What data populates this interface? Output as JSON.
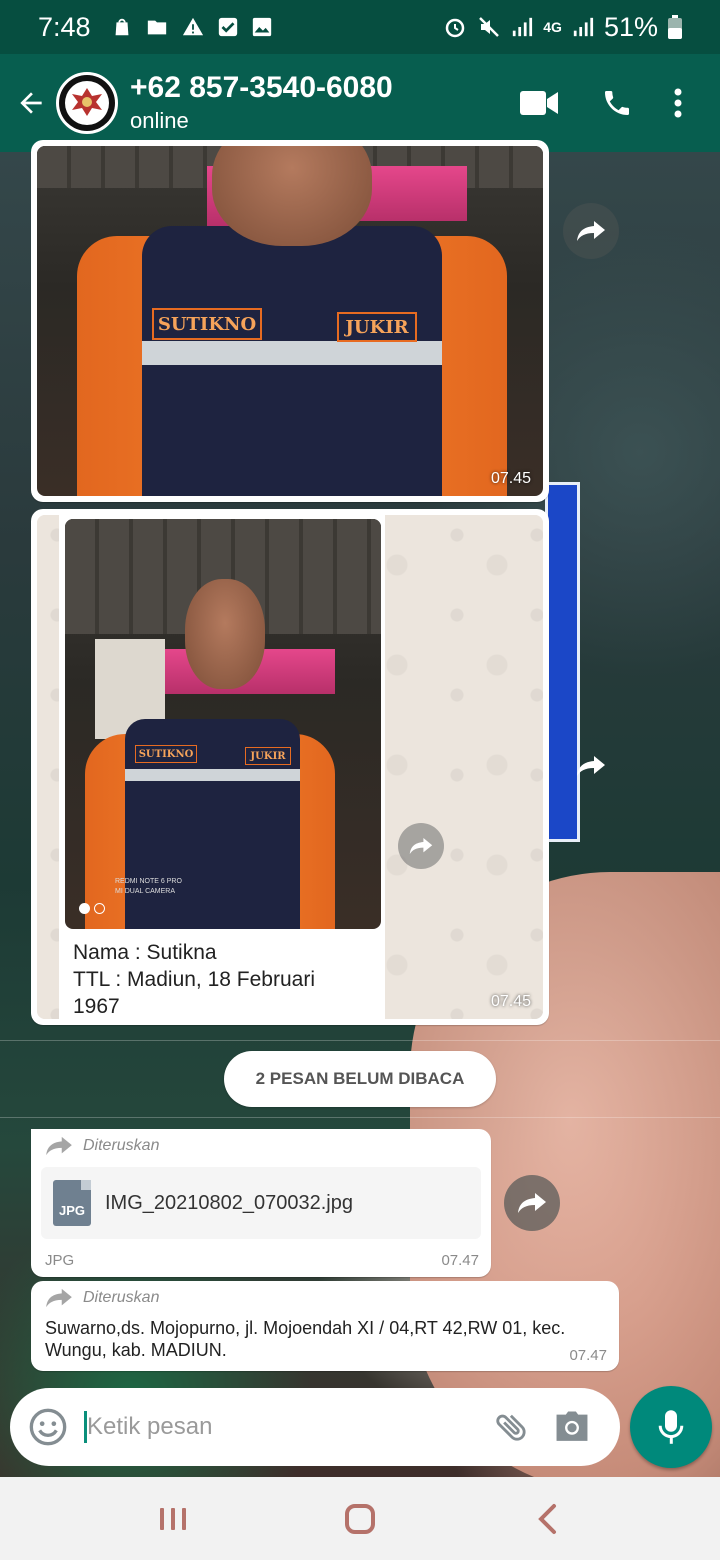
{
  "status_bar": {
    "time": "7:48",
    "battery": "51%",
    "network": "4G"
  },
  "header": {
    "contact_name": "+62 857-3540-6080",
    "status": "online",
    "icons": [
      "back-arrow-icon",
      "video-call-icon",
      "voice-call-icon",
      "more-vert-icon"
    ]
  },
  "messages": [
    {
      "type": "image",
      "time": "07.45",
      "photo_labels": [
        "SUTIKNO",
        "JUKIR"
      ]
    },
    {
      "type": "image-with-caption",
      "time": "07.45",
      "photo_labels": [
        "SUTIKNO",
        "JUKIR"
      ],
      "camera_watermark": [
        "REDMI NOTE 6 PRO",
        "MI DUAL CAMERA"
      ],
      "caption_lines": [
        "Nama : Sutikna",
        "TTL : Madiun, 18 Februari",
        "1967"
      ]
    }
  ],
  "unread_divider": {
    "label": "2 PESAN BELUM DIBACA"
  },
  "forwarded_messages": [
    {
      "forwarded_label": "Diteruskan",
      "file_name": "IMG_20210802_070032.jpg",
      "file_icon_label": "JPG",
      "file_type": "JPG",
      "time": "07.47"
    },
    {
      "forwarded_label": "Diteruskan",
      "text": "Suwarno,ds. Mojopurno, jl. Mojoendah XI / 04,RT 42,RW  01, kec. Wungu, kab. MADIUN.",
      "time": "07.47"
    }
  ],
  "composer": {
    "placeholder": "Ketik pesan"
  },
  "colors": {
    "header": "#075e4f",
    "status_bar": "#064e40",
    "accent": "#00897b",
    "bubble": "#ffffff"
  }
}
